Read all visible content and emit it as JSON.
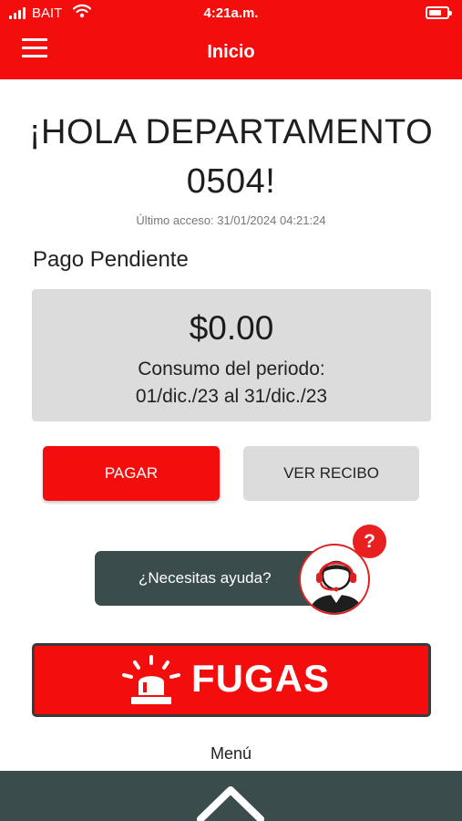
{
  "status_bar": {
    "carrier": "BAIT",
    "time": "4:21a.m."
  },
  "nav": {
    "title": "Inicio",
    "menu_icon": "hamburger-menu-icon"
  },
  "greeting": {
    "line1": "¡HOLA DEPARTAMENTO",
    "line2": "0504!",
    "last_access": "Último acceso: 31/01/2024 04:21:24"
  },
  "payment": {
    "section_label": "Pago Pendiente",
    "amount": "$0.00",
    "period_label": "Consumo del periodo:",
    "period_range": "01/dic./23 al 31/dic./23"
  },
  "actions": {
    "pay_label": "PAGAR",
    "receipt_label": "VER RECIBO"
  },
  "help": {
    "label": "¿Necesitas ayuda?",
    "badge": "?",
    "avatar_icon": "support-agent-icon"
  },
  "leaks": {
    "label": "FUGAS",
    "icon": "alarm-siren-icon"
  },
  "footer": {
    "menu_label": "Menú",
    "expand_icon": "chevron-up-icon"
  },
  "colors": {
    "brand_red": "#f40d0d",
    "dark_slate": "#3a4c4c",
    "card_gray": "#dcdcdc"
  }
}
